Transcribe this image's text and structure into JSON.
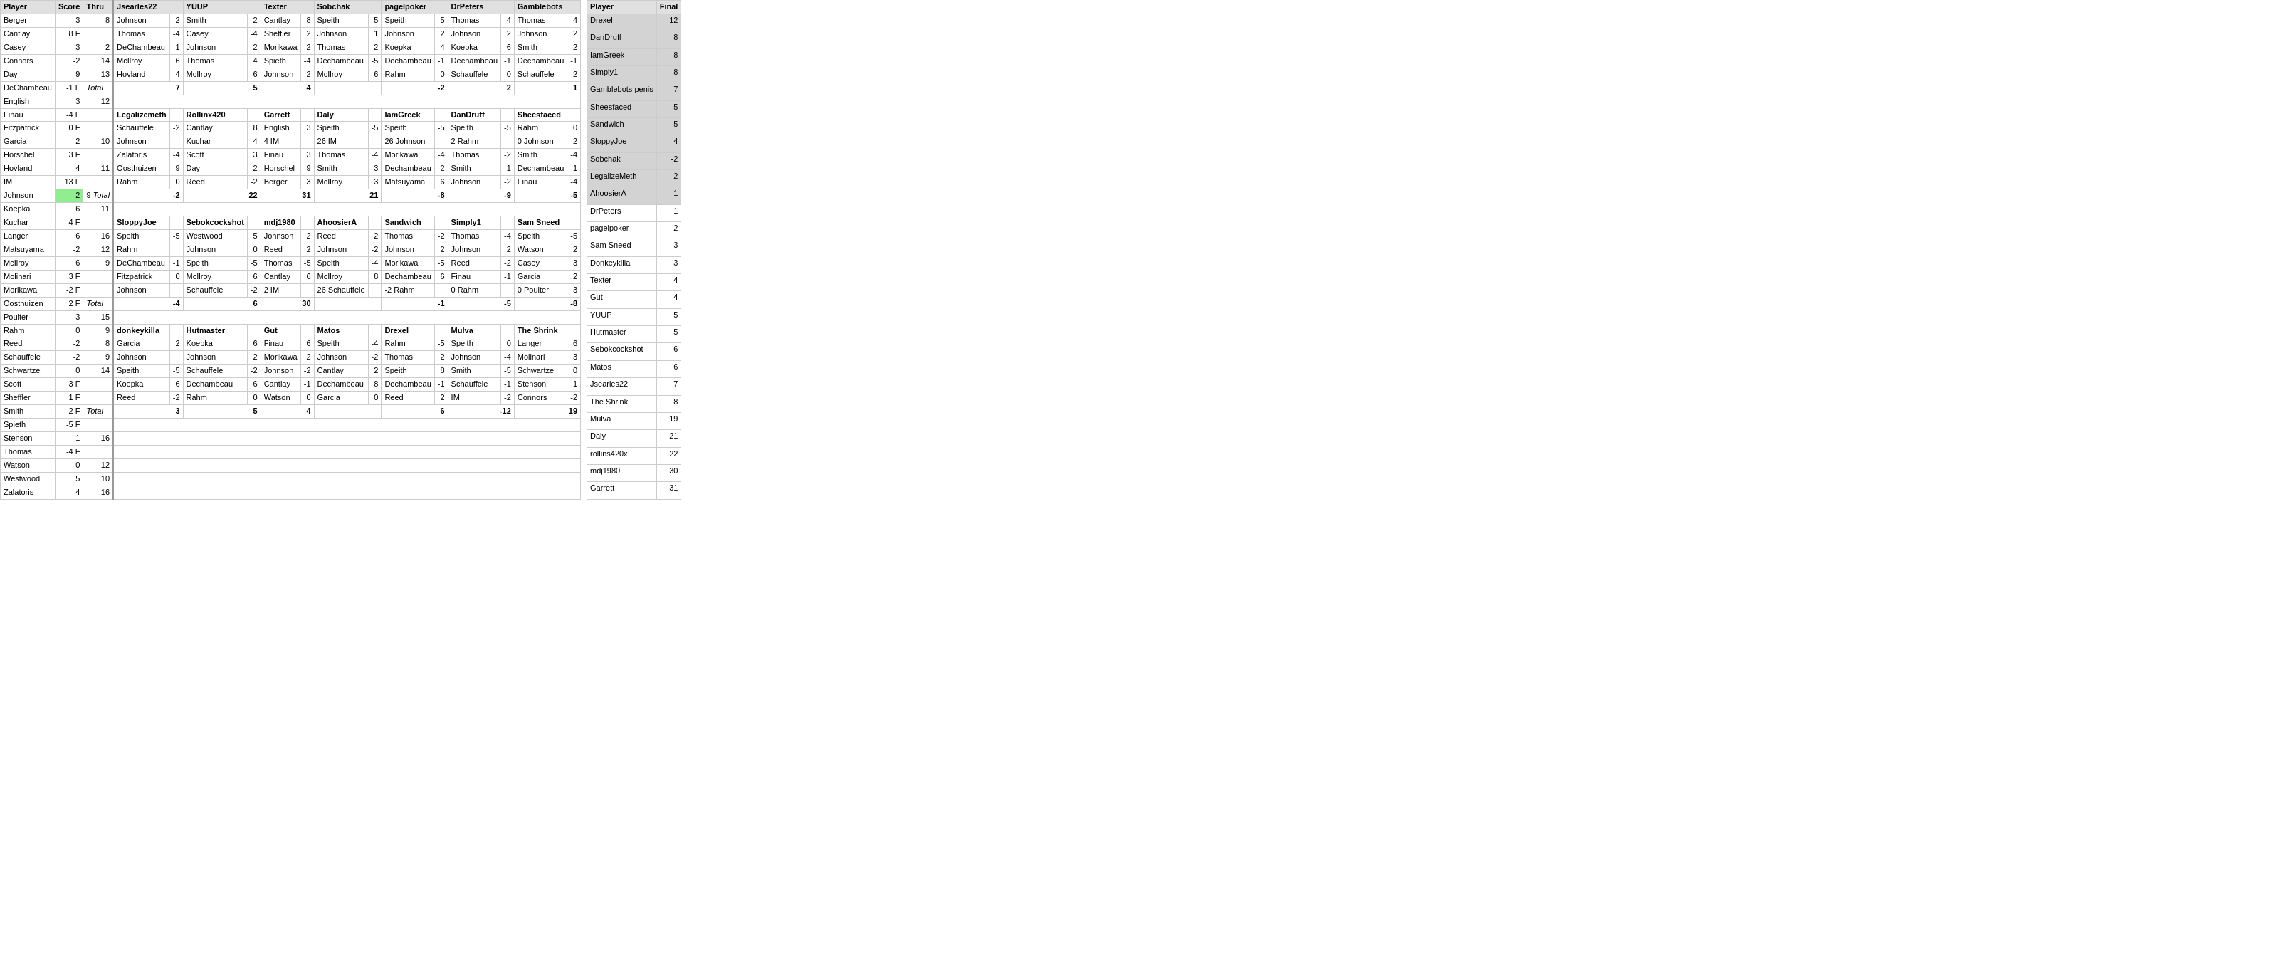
{
  "columns": {
    "main_headers": [
      "Player",
      "Score",
      "Thru"
    ],
    "pool_headers": [
      "Jsearles22",
      "YUUP",
      "Texter",
      "Sobchak",
      "pagelpoker",
      "DrPeters",
      "Gamblebots"
    ],
    "final_headers": [
      "Player",
      "Final"
    ]
  },
  "players": [
    {
      "name": "Berger",
      "score": "3",
      "thru": "8"
    },
    {
      "name": "Cantlay",
      "score": "8 F",
      "thru": ""
    },
    {
      "name": "Casey",
      "score": "3",
      "thru": "2"
    },
    {
      "name": "Connors",
      "score": "-2",
      "thru": "14"
    },
    {
      "name": "Day",
      "score": "9",
      "thru": "13"
    },
    {
      "name": "DeChambeau",
      "score": "-1 F",
      "thru": ""
    },
    {
      "name": "English",
      "score": "3",
      "thru": "12"
    },
    {
      "name": "Finau",
      "score": "-4 F",
      "thru": ""
    },
    {
      "name": "Fitzpatrick",
      "score": "0 F",
      "thru": ""
    },
    {
      "name": "Garcia",
      "score": "2",
      "thru": "10"
    },
    {
      "name": "Horschel",
      "score": "3 F",
      "thru": ""
    },
    {
      "name": "Hovland",
      "score": "4",
      "thru": "11"
    },
    {
      "name": "IM",
      "score": "13 F",
      "thru": ""
    },
    {
      "name": "Johnson",
      "score": "2",
      "thru": "9",
      "highlight": true
    },
    {
      "name": "Koepka",
      "score": "6",
      "thru": "11"
    },
    {
      "name": "Kuchar",
      "score": "4 F",
      "thru": ""
    },
    {
      "name": "Langer",
      "score": "6",
      "thru": "16"
    },
    {
      "name": "Matsuyama",
      "score": "-2",
      "thru": "12"
    },
    {
      "name": "McIlroy",
      "score": "6",
      "thru": "9"
    },
    {
      "name": "Molinari",
      "score": "3 F",
      "thru": ""
    },
    {
      "name": "Morikawa",
      "score": "-2 F",
      "thru": ""
    },
    {
      "name": "Oosthuizen",
      "score": "2 F",
      "thru": ""
    },
    {
      "name": "Poulter",
      "score": "3",
      "thru": "15"
    },
    {
      "name": "Rahm",
      "score": "0",
      "thru": "9"
    },
    {
      "name": "Reed",
      "score": "-2",
      "thru": "8"
    },
    {
      "name": "Schauffele",
      "score": "-2",
      "thru": "9"
    },
    {
      "name": "Schwartzel",
      "score": "0",
      "thru": "14"
    },
    {
      "name": "Scott",
      "score": "3 F",
      "thru": ""
    },
    {
      "name": "Sheffler",
      "score": "1 F",
      "thru": ""
    },
    {
      "name": "Smith",
      "score": "-2 F",
      "thru": ""
    },
    {
      "name": "Spieth",
      "score": "-5 F",
      "thru": ""
    },
    {
      "name": "Stenson",
      "score": "1",
      "thru": "16"
    },
    {
      "name": "Thomas",
      "score": "-4 F",
      "thru": ""
    },
    {
      "name": "Watson",
      "score": "0",
      "thru": "12"
    },
    {
      "name": "Westwood",
      "score": "5",
      "thru": "10"
    },
    {
      "name": "Zalatoris",
      "score": "-4",
      "thru": "16"
    }
  ],
  "jsearles22": {
    "picks": [
      {
        "player": "Johnson",
        "score": "2"
      },
      {
        "player": "Thomas",
        "score": "-4"
      },
      {
        "player": "DeChambeau",
        "score": ""
      },
      {
        "player": "McIlroy",
        "score": "6"
      },
      {
        "player": "Hovland",
        "score": "4"
      },
      {
        "player": "",
        "score": ""
      },
      {
        "player": "",
        "score": "Total",
        "total": "7"
      },
      {
        "player": "",
        "score": ""
      },
      {
        "player": "Legalizemeth",
        "score": "",
        "bold": true
      },
      {
        "player": "Schauffele",
        "score": "-2"
      },
      {
        "player": "Johnson",
        "score": ""
      },
      {
        "player": "Zalatoris",
        "score": "-4"
      },
      {
        "player": "Oosthuizen",
        "score": ""
      },
      {
        "player": "Rahm",
        "score": "0"
      },
      {
        "player": "",
        "score": "-2"
      },
      {
        "player": "",
        "score": ""
      },
      {
        "player": "",
        "score": ""
      },
      {
        "player": "SloppyJoe",
        "score": "",
        "bold": true
      },
      {
        "player": "Speith",
        "score": "-5"
      },
      {
        "player": "Rahm",
        "score": ""
      },
      {
        "player": "DeChambeau",
        "score": "-1"
      },
      {
        "player": "Fitzpatrick",
        "score": "0"
      },
      {
        "player": "Johnson",
        "score": ""
      },
      {
        "player": "",
        "score": "-4"
      },
      {
        "player": "",
        "score": ""
      },
      {
        "player": "",
        "score": ""
      },
      {
        "player": "donkeykilla",
        "score": "",
        "bold": true
      },
      {
        "player": "Garcia",
        "score": "2"
      },
      {
        "player": "Johnson",
        "score": ""
      },
      {
        "player": "Speith",
        "score": "-5"
      },
      {
        "player": "Koepka",
        "score": "6"
      },
      {
        "player": "Reed",
        "score": "-2"
      },
      {
        "player": "",
        "score": "3"
      }
    ]
  },
  "final_standings": [
    {
      "player": "Drexel",
      "score": "-12"
    },
    {
      "player": "DanDruff",
      "score": "-8"
    },
    {
      "player": "IamGreek",
      "score": "-8"
    },
    {
      "player": "Simply1",
      "score": "-8"
    },
    {
      "player": "Gamblebots penis",
      "score": "-7"
    },
    {
      "player": "Sheesfaced",
      "score": "-5"
    },
    {
      "player": "Sandwich",
      "score": "-5"
    },
    {
      "player": "SloppyJoe",
      "score": "-4"
    },
    {
      "player": "Sobchak",
      "score": "-2"
    },
    {
      "player": "LegalizeMeth",
      "score": "-2"
    },
    {
      "player": "AhoosierA",
      "score": "-1"
    },
    {
      "player": "DrPeters",
      "score": "1"
    },
    {
      "player": "pagelpoker",
      "score": "2"
    },
    {
      "player": "Sam Sneed",
      "score": "3"
    },
    {
      "player": "Donkeykilla",
      "score": "3"
    },
    {
      "player": "Texter",
      "score": "4"
    },
    {
      "player": "Gut",
      "score": "4"
    },
    {
      "player": "YUUP",
      "score": "5"
    },
    {
      "player": "Hutmaster",
      "score": "5"
    },
    {
      "player": "Sebokcockshot",
      "score": "6"
    },
    {
      "player": "Matos",
      "score": "6"
    },
    {
      "player": "Jsearles22",
      "score": "7"
    },
    {
      "player": "The Shrink",
      "score": "8"
    },
    {
      "player": "Mulva",
      "score": "19"
    },
    {
      "player": "Daly",
      "score": "21"
    },
    {
      "player": "rollins420x",
      "score": "22"
    },
    {
      "player": "mdj1980",
      "score": "30"
    },
    {
      "player": "Garrett",
      "score": "31"
    }
  ]
}
